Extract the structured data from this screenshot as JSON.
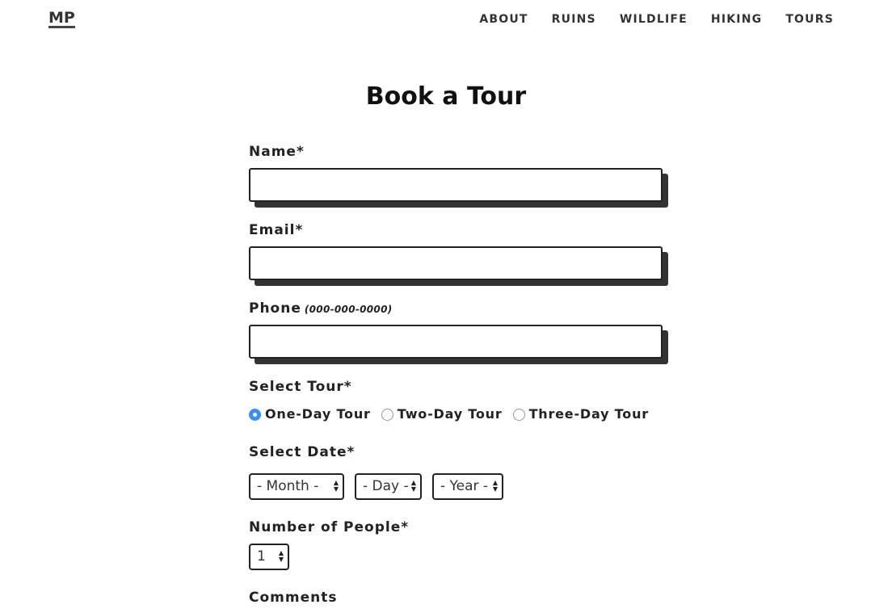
{
  "header": {
    "logo": "MP",
    "nav": [
      "ABOUT",
      "RUINS",
      "WILDLIFE",
      "HIKING",
      "TOURS"
    ]
  },
  "page_title": "Book a Tour",
  "form": {
    "name_label": "Name*",
    "email_label": "Email*",
    "phone_label": "Phone",
    "phone_hint": "(000-000-0000)",
    "name_value": "",
    "email_value": "",
    "phone_value": "",
    "tour_label": "Select Tour*",
    "tour_options": [
      "One-Day Tour",
      "Two-Day Tour",
      "Three-Day Tour"
    ],
    "tour_selected": "One-Day Tour",
    "date_label": "Select Date*",
    "month_value": "- Month -",
    "day_value": "- Day -",
    "year_value": "- Year -",
    "people_label": "Number of People*",
    "people_value": "1",
    "comments_label": "Comments"
  },
  "colors": {
    "accent": "#3b8ff0",
    "border": "#222222",
    "shadow": "#333333"
  }
}
